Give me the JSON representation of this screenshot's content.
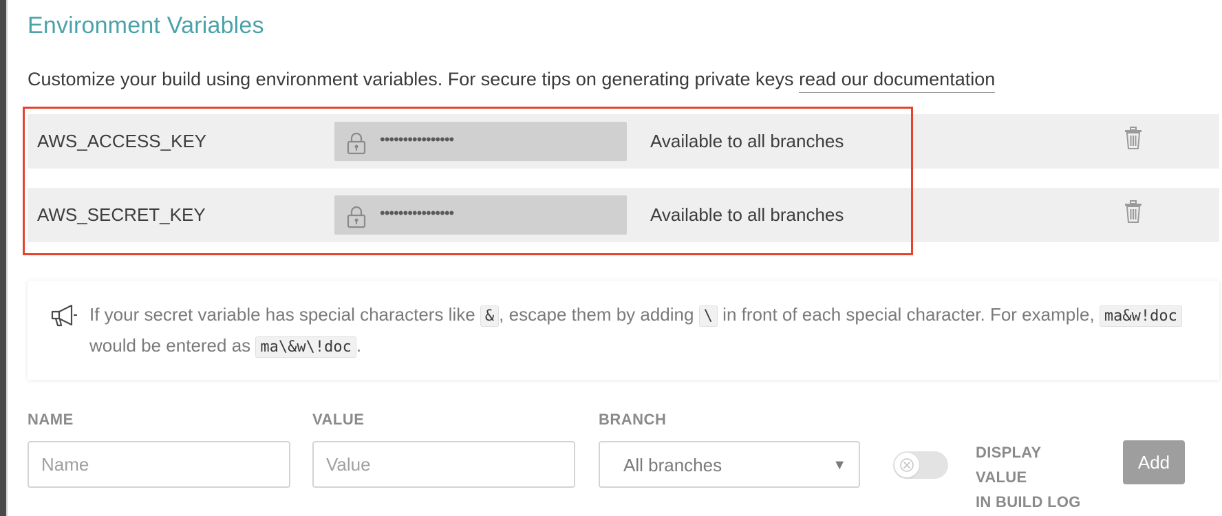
{
  "page": {
    "title": "Environment Variables",
    "intro_text": "Customize your build using environment variables. For secure tips on generating private keys ",
    "doc_link_label": "read our documentation"
  },
  "env_vars": [
    {
      "name": "AWS_ACCESS_KEY",
      "masked_value": "••••••••••••••••",
      "branch": "Available to all branches",
      "icons": {
        "lock": "lock-icon",
        "delete": "trash-icon"
      }
    },
    {
      "name": "AWS_SECRET_KEY",
      "masked_value": "••••••••••••••••",
      "branch": "Available to all branches",
      "icons": {
        "lock": "lock-icon",
        "delete": "trash-icon"
      }
    }
  ],
  "note": {
    "icon": "megaphone-icon",
    "part1": "If your secret variable has special characters like ",
    "code1": "&",
    "part2": ", escape them by adding ",
    "code2": "\\",
    "part3": " in front of each special character. For example, ",
    "code3": "ma&w!doc",
    "part4": " would be entered as ",
    "code4": "ma\\&w\\!doc",
    "part5": "."
  },
  "form": {
    "name_label": "NAME",
    "name_placeholder": "Name",
    "value_label": "VALUE",
    "value_placeholder": "Value",
    "branch_label": "BRANCH",
    "branch_selected": "All branches",
    "display_value_label_line1": "DISPLAY VALUE",
    "display_value_label_line2": "IN BUILD LOG",
    "display_value_enabled": false,
    "add_label": "Add"
  },
  "colors": {
    "title": "#4aa3a9",
    "highlight": "#e2442c",
    "row_background": "#efefef",
    "add_button": "#9e9e9e"
  }
}
